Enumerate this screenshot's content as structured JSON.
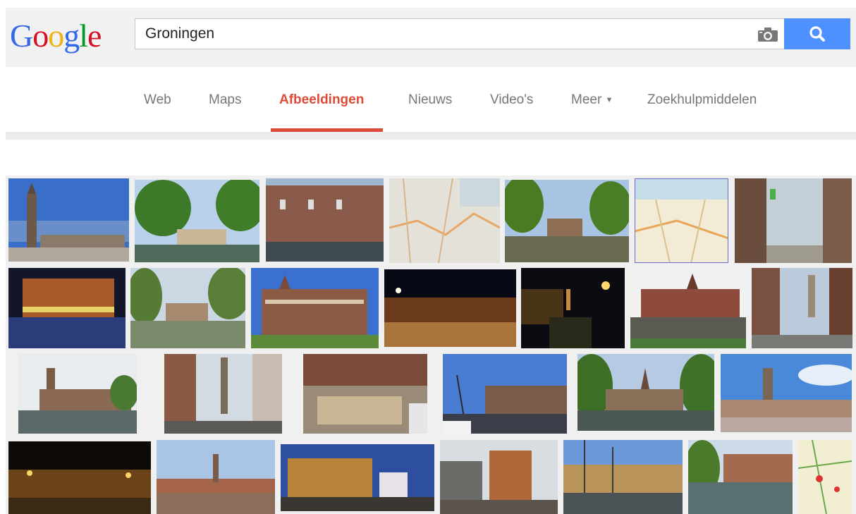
{
  "search": {
    "query": "Groningen",
    "placeholder": ""
  },
  "logo": {
    "letters": [
      "G",
      "o",
      "o",
      "g",
      "l",
      "e"
    ],
    "colors": [
      "#3369e8",
      "#d50f25",
      "#eeb211",
      "#3369e8",
      "#009925",
      "#d50f25"
    ]
  },
  "nav": {
    "tabs": [
      {
        "label": "Web",
        "active": false
      },
      {
        "label": "Maps",
        "active": false
      },
      {
        "label": "Afbeeldingen",
        "active": true
      },
      {
        "label": "Nieuws",
        "active": false
      },
      {
        "label": "Video's",
        "active": false
      },
      {
        "label": "Meer",
        "active": false,
        "dropdown": true
      },
      {
        "label": "Zoekhulpmiddelen",
        "active": false
      }
    ]
  },
  "colors": {
    "accent": "#dd4b39",
    "search_button": "#4d90fe",
    "tab_text": "#777777"
  },
  "icons": {
    "camera": "camera-icon",
    "search": "search-icon",
    "dropdown": "caret-down-icon"
  }
}
